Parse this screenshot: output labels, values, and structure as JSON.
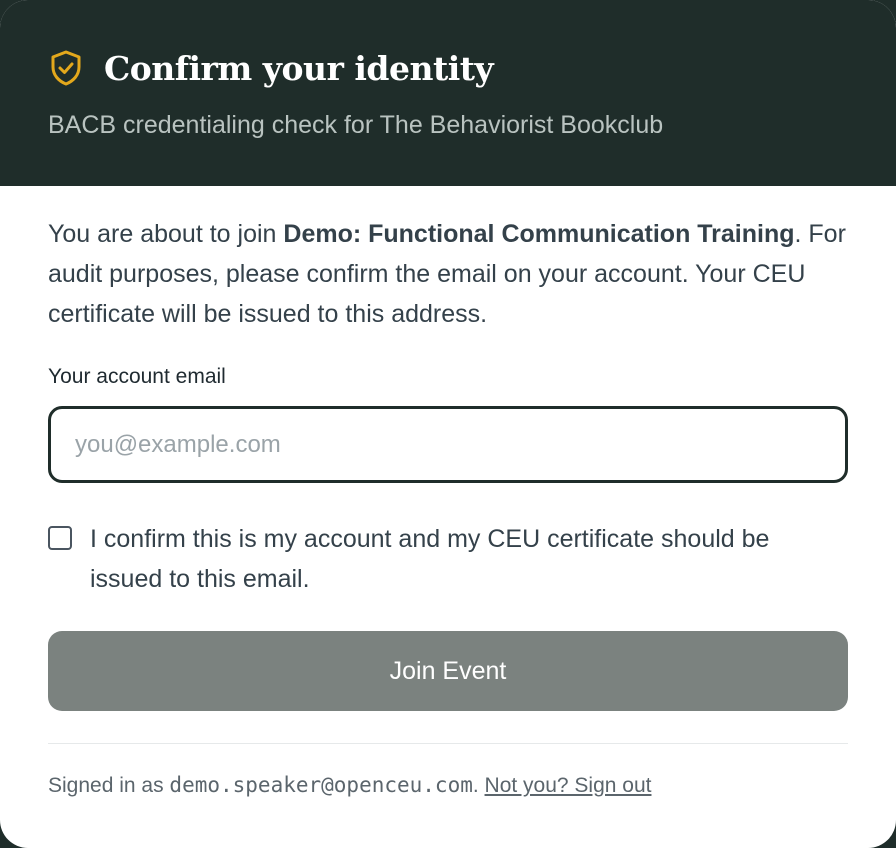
{
  "header": {
    "title": "Confirm your identity",
    "subtitle": "BACB credentialing check for The Behaviorist Bookclub",
    "icon": "shield-check-icon",
    "accent_color": "#e3a81c",
    "background_color": "#1f2d2a"
  },
  "intro": {
    "prefix": "You are about to join ",
    "event_name": "Demo: Functional Communication Training",
    "suffix": ". For audit purposes, please confirm the email on your account. Your CEU certificate will be issued to this address."
  },
  "email_field": {
    "label": "Your account email",
    "value": "",
    "placeholder": "you@example.com"
  },
  "confirm": {
    "checked": false,
    "label": "I confirm this is my account and my CEU certificate should be issued to this email."
  },
  "join_button": {
    "label": "Join Event",
    "disabled_color": "#7b827f"
  },
  "footer": {
    "prefix": "Signed in as ",
    "email": "demo.speaker@openceu.com",
    "separator": ". ",
    "sign_out_label": "Not you? Sign out"
  }
}
